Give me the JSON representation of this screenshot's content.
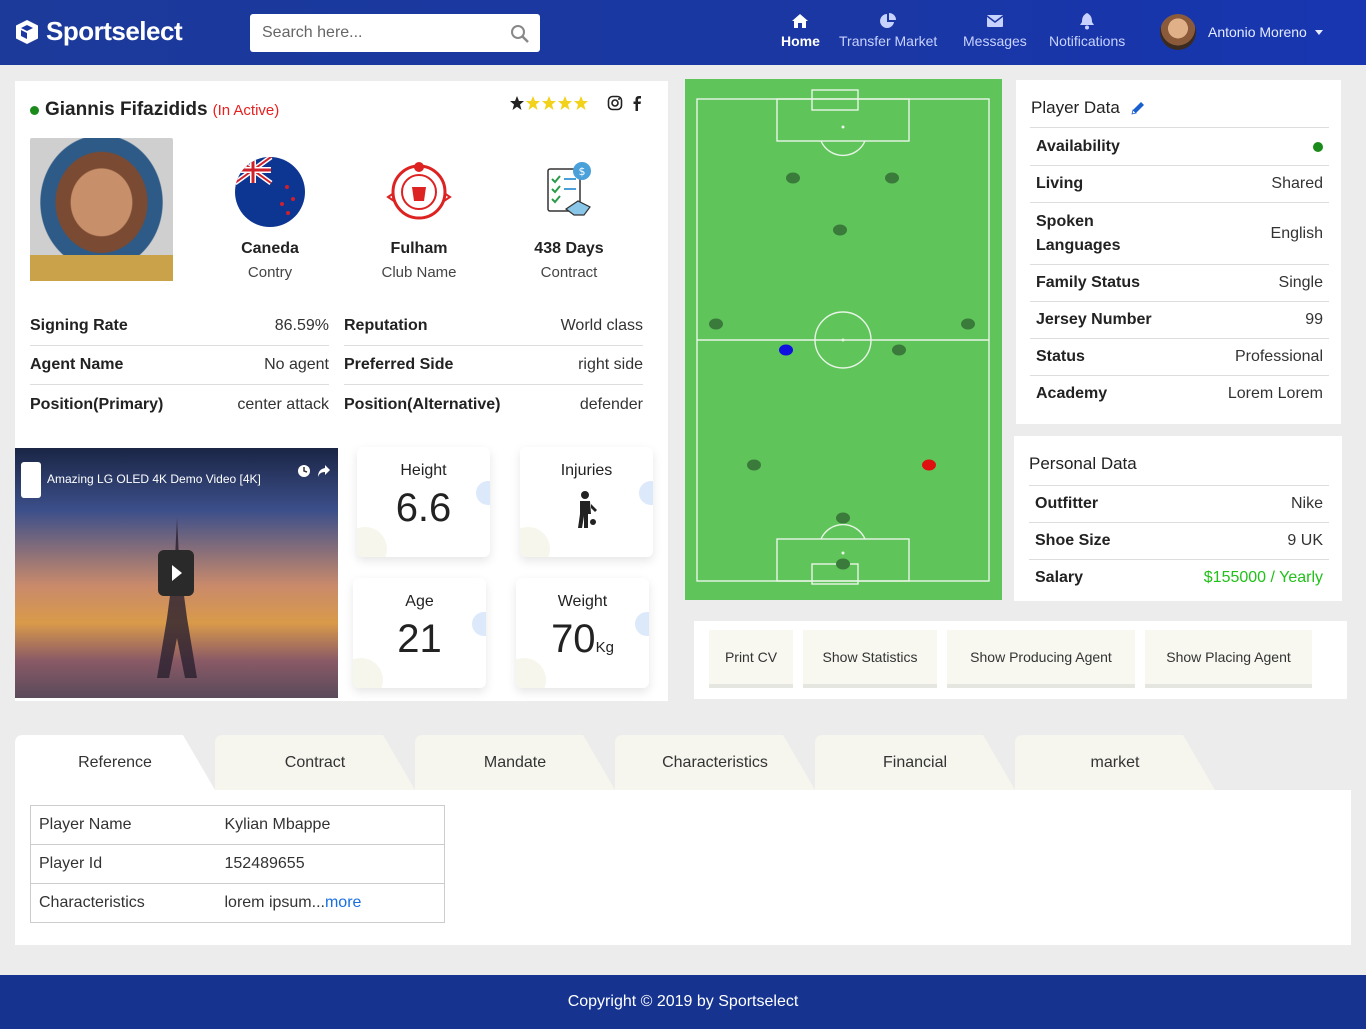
{
  "brand": "Sportselect",
  "search": {
    "placeholder": "Search here..."
  },
  "nav": [
    {
      "label": "Home",
      "icon": "home-icon"
    },
    {
      "label": "Transfer Market",
      "icon": "pie-chart-icon"
    },
    {
      "label": "Messages",
      "icon": "envelope-icon"
    },
    {
      "label": "Notifications",
      "icon": "bell-icon"
    }
  ],
  "user": {
    "name": "Antonio Moreno"
  },
  "player": {
    "name": "Giannis Fifazidids",
    "status": "(In Active)",
    "rating": 5,
    "country": {
      "value": "Caneda",
      "label": "Contry"
    },
    "club": {
      "value": "Fulham",
      "label": "Club Name"
    },
    "contract": {
      "value": "438 Days",
      "label": "Contract"
    },
    "info_left": [
      {
        "k": "Signing Rate",
        "v": "86.59%"
      },
      {
        "k": "Agent Name",
        "v": "No agent"
      },
      {
        "k": "Position(Primary)",
        "v": "center attack"
      }
    ],
    "info_right": [
      {
        "k": "Reputation",
        "v": "World class"
      },
      {
        "k": "Preferred Side",
        "v": "right side"
      },
      {
        "k": "Position(Alternative)",
        "v": "defender"
      }
    ],
    "video_title": "Amazing LG OLED 4K Demo Video [4K]",
    "height": {
      "label": "Height",
      "value": "6.6"
    },
    "injuries": {
      "label": "Injuries"
    },
    "age": {
      "label": "Age",
      "value": "21"
    },
    "weight": {
      "label": "Weight",
      "value": "70",
      "unit": "Kg"
    }
  },
  "player_data": {
    "title": "Player Data",
    "rows": [
      {
        "k": "Availability",
        "v": ""
      },
      {
        "k": "Living",
        "v": "Shared"
      },
      {
        "k": "Spoken Languages",
        "v": "English"
      },
      {
        "k": "Family Status",
        "v": "Single"
      },
      {
        "k": "Jersey Number",
        "v": "99"
      },
      {
        "k": "Status",
        "v": "Professional"
      },
      {
        "k": "Academy",
        "v": "Lorem Lorem"
      }
    ]
  },
  "personal_data": {
    "title": "Personal Data",
    "rows": [
      {
        "k": "Outfitter",
        "v": "Nike"
      },
      {
        "k": "Shoe Size",
        "v": "9 UK"
      },
      {
        "k": "Salary",
        "v": "$155000 / Yearly"
      }
    ]
  },
  "buttons": [
    "Print CV",
    "Show Statistics",
    "Show Producing Agent",
    "Show Placing Agent"
  ],
  "tabs": [
    "Reference",
    "Contract",
    "Mandate",
    "Characteristics",
    "Financial",
    "market"
  ],
  "reference": [
    {
      "k": "Player Name",
      "v": "Kylian Mbappe"
    },
    {
      "k": "Player Id",
      "v": "152489655"
    },
    {
      "k": "Characteristics",
      "v": "lorem ipsum...",
      "link": "more"
    }
  ],
  "footer": "Copyright © 2019 by Sportselect",
  "colors": {
    "brand": "#1a37a3",
    "pitch": "#5fc45a",
    "salary": "#22c01a",
    "inactive": "#e8201f"
  }
}
